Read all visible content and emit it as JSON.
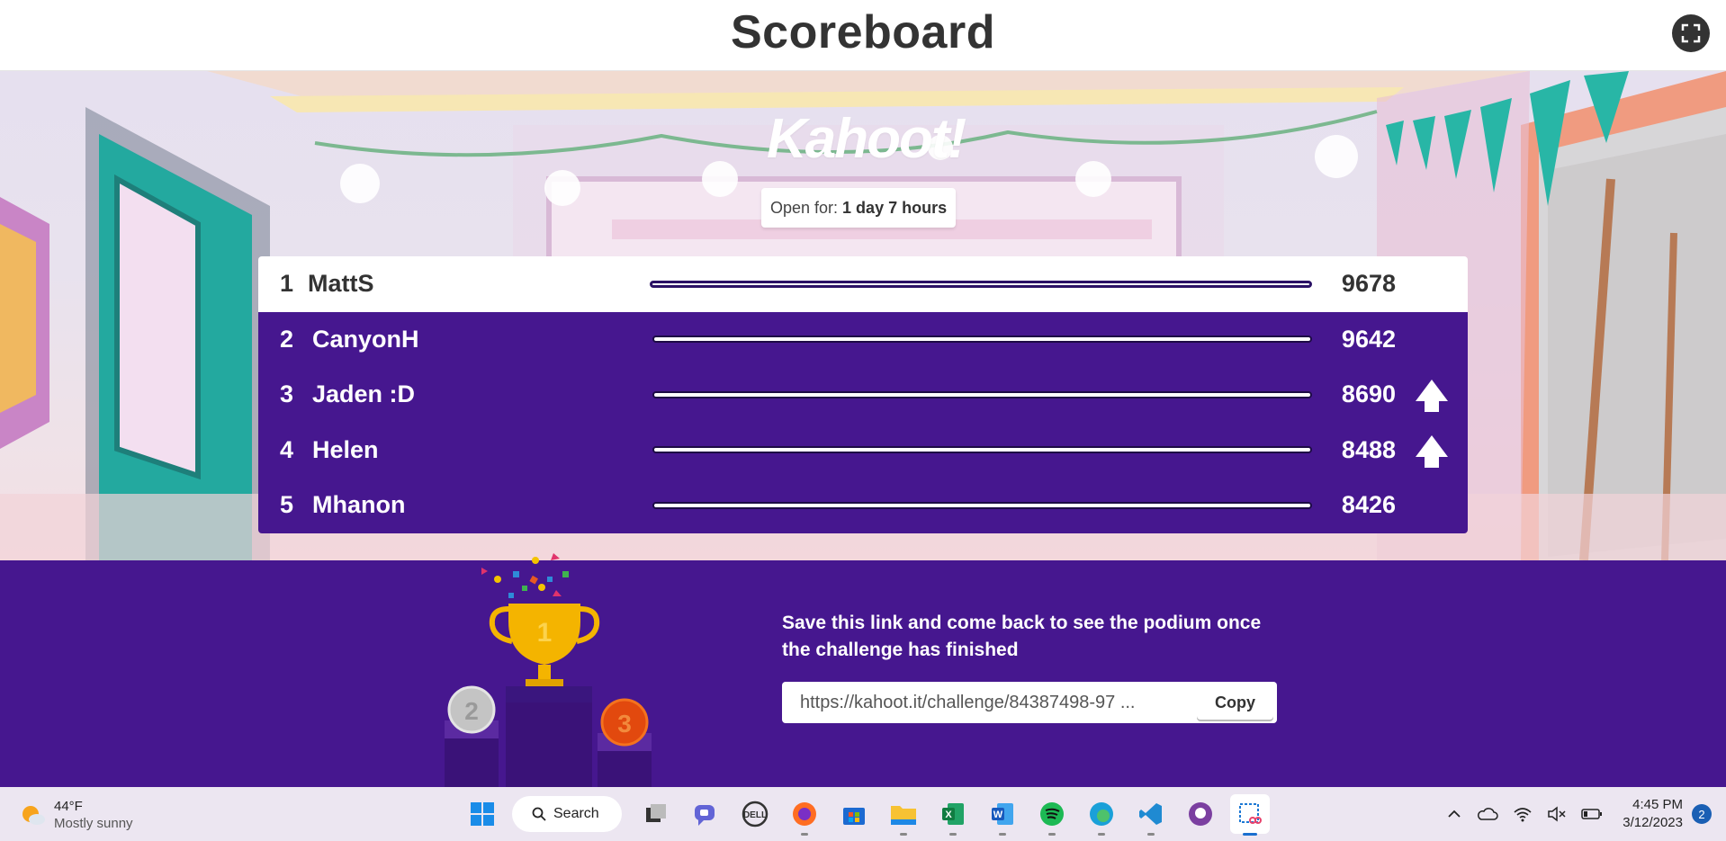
{
  "header": {
    "title": "Scoreboard",
    "fullscreen_icon": "fullscreen-icon"
  },
  "brand": {
    "logo_text": "Kahoot!"
  },
  "open_for": {
    "label": "Open for:",
    "value": "1 day 7 hours"
  },
  "leaderboard": [
    {
      "rank": "1",
      "name": "MattS",
      "score": "9678",
      "trend": ""
    },
    {
      "rank": "2",
      "name": "CanyonH",
      "score": "9642",
      "trend": ""
    },
    {
      "rank": "3",
      "name": "Jaden :D",
      "score": "8690",
      "trend": "up"
    },
    {
      "rank": "4",
      "name": "Helen",
      "score": "8488",
      "trend": "up"
    },
    {
      "rank": "5",
      "name": "Mhanon",
      "score": "8426",
      "trend": ""
    }
  ],
  "podium": {
    "message": "Save this link and come back to see the podium once the challenge has finished",
    "link": "https://kahoot.it/challenge/84387498-97 ...",
    "copy_label": "Copy",
    "places": [
      "1",
      "2",
      "3"
    ]
  },
  "taskbar": {
    "weather": {
      "temp": "44°F",
      "condition": "Mostly sunny"
    },
    "search_label": "Search",
    "apps": [
      "windows-start",
      "search",
      "task-view",
      "teams-chat",
      "dell",
      "firefox",
      "microsoft-store",
      "file-explorer",
      "excel",
      "word",
      "spotify",
      "edge",
      "vscode",
      "github-desktop",
      "snipping-tool"
    ],
    "clock": {
      "time": "4:45 PM",
      "date": "3/12/2023"
    },
    "notifications": "2"
  },
  "colors": {
    "kahoot_purple": "#46178f",
    "text_dark": "#333333"
  }
}
